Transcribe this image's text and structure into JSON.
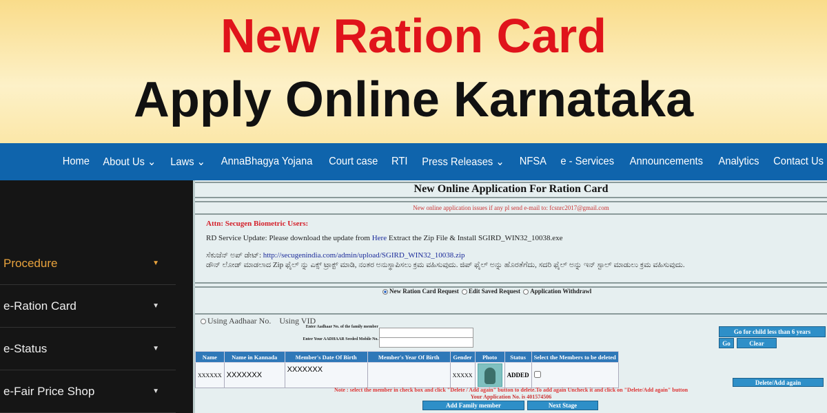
{
  "banner": {
    "line1": "New Ration Card",
    "line2": "Apply Online Karnataka"
  },
  "nav": [
    "Home",
    "About Us ⌄",
    "Laws ⌄",
    "AnnaBhagya Yojana",
    "Court case",
    "RTI",
    "Press Releases ⌄",
    "NFSA",
    "e - Services",
    "Announcements",
    "Analytics",
    "Contact Us"
  ],
  "sidebar": [
    {
      "label": "Procedure",
      "active": true
    },
    {
      "label": "e-Ration Card"
    },
    {
      "label": "e-Status"
    },
    {
      "label": "e-Fair Price Shop"
    }
  ],
  "form": {
    "title": "New Online Application For Ration Card",
    "mail_note": "New online application issues if any pl send e-mail to: fcsnrc2017@gmail.com",
    "attn": "Attn: Secugen Biometric Users:",
    "rd_prefix": "RD Service Update: Please download the update from",
    "rd_link": "Here",
    "rd_suffix": "Extract the Zip File & Install SGIRD_WIN32_10038.exe",
    "kn_label": "ಸೆಕುಜೆನ್ ಅಪ್ ಡೇಟ್:",
    "kn_link": "http://secugenindia.com/admin/upload/SGIRD_WIN32_10038.zip",
    "kn_text": "ಡೌನ್ ಲೋಡ್ ಮಾಡಲಾದ Zip ಫೈಲ್ ನ್ನು ಎಕ್ಸ್ ಟ್ರಾಕ್ಟ್ ಮಾಡಿ, ನಂತರ ಅನುಸ್ಥಾಪಿಸಲು ಕ್ರಮ ವಹಿಸುವುದು. ಜಿಪ್ ಫೈಲ್ ಅನ್ನು ಹೊರತೆಗೆದು, ಸದರಿ ಫೈಲ್ ಅನ್ನು ಇನ್ ಸ್ಟಾಲ್ ಮಾಡುಲು ಕ್ರಮ ವಹಿಸುವುದು.",
    "request_types": [
      "New Ration Card Request",
      "Edit Saved Request",
      "Application Withdrawl"
    ],
    "id_types": [
      "Using Aadhaar No.",
      "Using VID"
    ],
    "aadhaar_label": "Enter Aadhaar No. of the family member",
    "mobile_label": "Enter Your AADHAAR Seeded Mobile No.",
    "btn_child": "Go for child less than 6 years",
    "btn_go": "Go",
    "btn_clear": "Clear",
    "columns": [
      "Name",
      "Name in Kannada",
      "Member's Date Of Birth",
      "Member's Year Of Birth",
      "Gender",
      "Photo",
      "Status",
      "Select the Members to be deleted"
    ],
    "row": {
      "name": "XXXXXX",
      "kannada": "XXXXXXX",
      "dob": "XXXXXXX",
      "yob": "",
      "gender": "XXXXX",
      "status": "ADDED"
    },
    "btn_delete": "Delete/Add again",
    "note": "Note : select the member in check box and click \"Delete / Add again\" button to delete.To add again Uncheck it and click on \"Delete/Add again\" button",
    "app_no": "Your Application No. is 401574506",
    "btn_add": "Add Family member",
    "btn_next": "Next Stage"
  }
}
